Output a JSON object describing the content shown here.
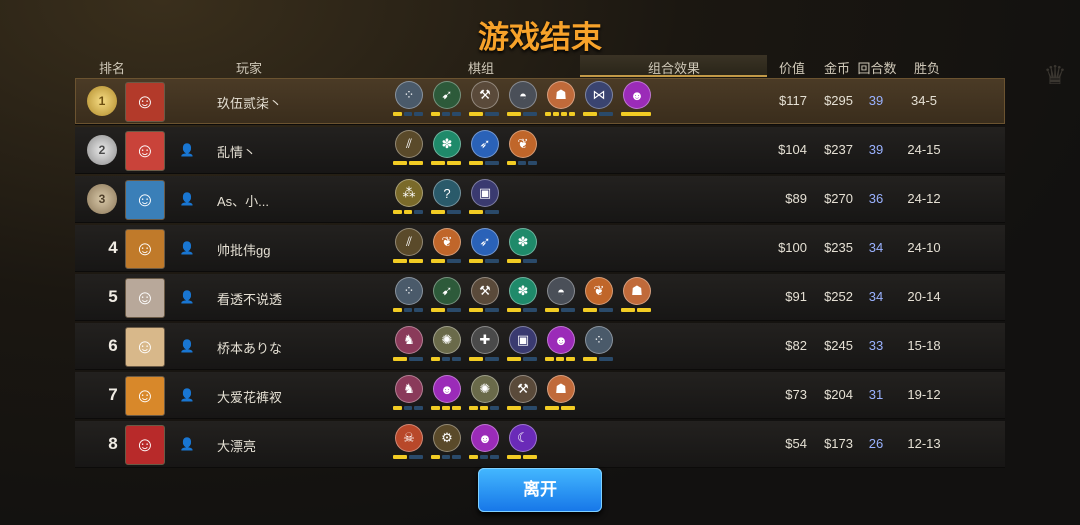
{
  "title": "游戏结束",
  "headers": {
    "rank": "排名",
    "player": "玩家",
    "pieces": "棋组",
    "synergy": "组合效果",
    "value": "价值",
    "gold": "金币",
    "rounds": "回合数",
    "winloss": "胜负"
  },
  "leave_button": "离开",
  "colors": {
    "accent_title": "#f7a22a",
    "bar_active": "#f2cc24",
    "bar_inactive": "#2a4a6a",
    "rounds_text": "#9ab2ff",
    "button_blue": "#1676e8"
  },
  "players": [
    {
      "rank": "1",
      "medal": "gold",
      "name": "玖伍贰柒丶",
      "friend_icon": false,
      "avatar_icon": "red-monster-avatar",
      "avatar_color": "#b33a2a",
      "traits": [
        {
          "icon": "paw-triad-icon",
          "color": "#4a5a6a",
          "active": 1,
          "total": 3
        },
        {
          "icon": "bow-icon",
          "color": "#2d5a3a",
          "active": 1,
          "total": 3
        },
        {
          "icon": "axe-icon",
          "color": "#5a4a3a",
          "active": 1,
          "total": 2
        },
        {
          "icon": "helmet-icon",
          "color": "#4a4f58",
          "active": 1,
          "total": 2
        },
        {
          "icon": "beast-face-icon",
          "color": "#c06a3a",
          "active": 4,
          "total": 4
        },
        {
          "icon": "fish-skeleton-icon",
          "color": "#3a4470",
          "active": 1,
          "total": 2
        },
        {
          "icon": "demon-icon",
          "color": "#9b2bb8",
          "active": 1,
          "total": 1
        }
      ],
      "value": "$117",
      "gold": "$295",
      "rounds": "39",
      "winloss": "34-5"
    },
    {
      "rank": "2",
      "medal": "silver",
      "name": "乱情丶",
      "friend_icon": true,
      "avatar_icon": "girl-green-goggles-avatar",
      "avatar_color": "#c9433a",
      "traits": [
        {
          "icon": "triple-spear-icon",
          "color": "#5a4a2a",
          "active": 2,
          "total": 2
        },
        {
          "icon": "paw-icon",
          "color": "#1f8a6a",
          "active": 2,
          "total": 2
        },
        {
          "icon": "feather-icon",
          "color": "#2a62b8",
          "active": 1,
          "total": 2
        },
        {
          "icon": "leaf-icon",
          "color": "#c0662a",
          "active": 1,
          "total": 3
        }
      ],
      "value": "$104",
      "gold": "$237",
      "rounds": "39",
      "winloss": "24-15"
    },
    {
      "rank": "3",
      "medal": "bronze",
      "name": "As、小...",
      "friend_icon": true,
      "avatar_icon": "armored-hero-avatar",
      "avatar_color": "#3a7fb8",
      "traits": [
        {
          "icon": "triple-orb-icon",
          "color": "#7a6a2a",
          "active": 2,
          "total": 3
        },
        {
          "icon": "question-rune-icon",
          "color": "#2a5a6a",
          "active": 1,
          "total": 2
        },
        {
          "icon": "mech-face-icon",
          "color": "#3a3a70",
          "active": 1,
          "total": 2
        }
      ],
      "value": "$89",
      "gold": "$270",
      "rounds": "36",
      "winloss": "24-12"
    },
    {
      "rank": "4",
      "medal": "",
      "name": "帅批伟gg",
      "friend_icon": true,
      "avatar_icon": "knight-avatar",
      "avatar_color": "#c07a2a",
      "traits": [
        {
          "icon": "triple-spear-icon",
          "color": "#5a4a2a",
          "active": 2,
          "total": 2
        },
        {
          "icon": "leaf-icon",
          "color": "#c0662a",
          "active": 1,
          "total": 2
        },
        {
          "icon": "feather-icon",
          "color": "#2a62b8",
          "active": 1,
          "total": 2
        },
        {
          "icon": "paw-icon",
          "color": "#1f8a6a",
          "active": 1,
          "total": 2
        }
      ],
      "value": "$100",
      "gold": "$235",
      "rounds": "34",
      "winloss": "24-10"
    },
    {
      "rank": "5",
      "medal": "",
      "name": "看透不说透",
      "friend_icon": true,
      "avatar_icon": "white-hair-avatar",
      "avatar_color": "#b8a89a",
      "traits": [
        {
          "icon": "paw-triad-icon",
          "color": "#4a5a6a",
          "active": 1,
          "total": 3
        },
        {
          "icon": "bow-icon",
          "color": "#2d5a3a",
          "active": 1,
          "total": 2
        },
        {
          "icon": "axe-icon",
          "color": "#5a4a3a",
          "active": 1,
          "total": 2
        },
        {
          "icon": "paw-icon",
          "color": "#1f8a6a",
          "active": 1,
          "total": 2
        },
        {
          "icon": "helmet-icon",
          "color": "#4a4f58",
          "active": 1,
          "total": 2
        },
        {
          "icon": "leaf-icon",
          "color": "#c0662a",
          "active": 1,
          "total": 2
        },
        {
          "icon": "beast-face-icon",
          "color": "#c06a3a",
          "active": 2,
          "total": 2
        }
      ],
      "value": "$91",
      "gold": "$252",
      "rounds": "34",
      "winloss": "20-14"
    },
    {
      "rank": "6",
      "medal": "",
      "name": "桥本ありな",
      "friend_icon": true,
      "avatar_icon": "blonde-girl-avatar",
      "avatar_color": "#d8b88a",
      "traits": [
        {
          "icon": "knight-piece-icon",
          "color": "#8a3a5a",
          "active": 1,
          "total": 2
        },
        {
          "icon": "shell-icon",
          "color": "#6a6a4a",
          "active": 1,
          "total": 3
        },
        {
          "icon": "cross-icon",
          "color": "#4a4a4a",
          "active": 1,
          "total": 2
        },
        {
          "icon": "mech-face-icon",
          "color": "#3a3a70",
          "active": 1,
          "total": 2
        },
        {
          "icon": "demon-icon",
          "color": "#9b2bb8",
          "active": 3,
          "total": 3
        },
        {
          "icon": "paw-triad-icon",
          "color": "#4a5a6a",
          "active": 1,
          "total": 2
        }
      ],
      "value": "$82",
      "gold": "$245",
      "rounds": "33",
      "winloss": "15-18"
    },
    {
      "rank": "7",
      "medal": "",
      "name": "大爱花裤衩",
      "friend_icon": true,
      "avatar_icon": "bear-hat-avatar",
      "avatar_color": "#d8882a",
      "traits": [
        {
          "icon": "knight-piece-icon",
          "color": "#8a3a5a",
          "active": 1,
          "total": 3
        },
        {
          "icon": "demon-icon",
          "color": "#9b2bb8",
          "active": 3,
          "total": 3
        },
        {
          "icon": "shell-icon",
          "color": "#6a6a4a",
          "active": 2,
          "total": 3
        },
        {
          "icon": "axe-icon",
          "color": "#5a4a3a",
          "active": 1,
          "total": 2
        },
        {
          "icon": "beast-face-icon",
          "color": "#c06a3a",
          "active": 2,
          "total": 2
        }
      ],
      "value": "$73",
      "gold": "$204",
      "rounds": "31",
      "winloss": "19-12"
    },
    {
      "rank": "8",
      "medal": "",
      "name": "大漂亮",
      "friend_icon": true,
      "avatar_icon": "red-dragon-avatar",
      "avatar_color": "#b82a2a",
      "traits": [
        {
          "icon": "ogre-icon",
          "color": "#b8482a",
          "active": 1,
          "total": 2
        },
        {
          "icon": "gear-icon",
          "color": "#5a4a2a",
          "active": 1,
          "total": 3
        },
        {
          "icon": "demon-icon",
          "color": "#9b2bb8",
          "active": 1,
          "total": 3
        },
        {
          "icon": "crescent-icon",
          "color": "#6a2ab8",
          "active": 2,
          "total": 2
        }
      ],
      "value": "$54",
      "gold": "$173",
      "rounds": "26",
      "winloss": "12-13"
    }
  ]
}
